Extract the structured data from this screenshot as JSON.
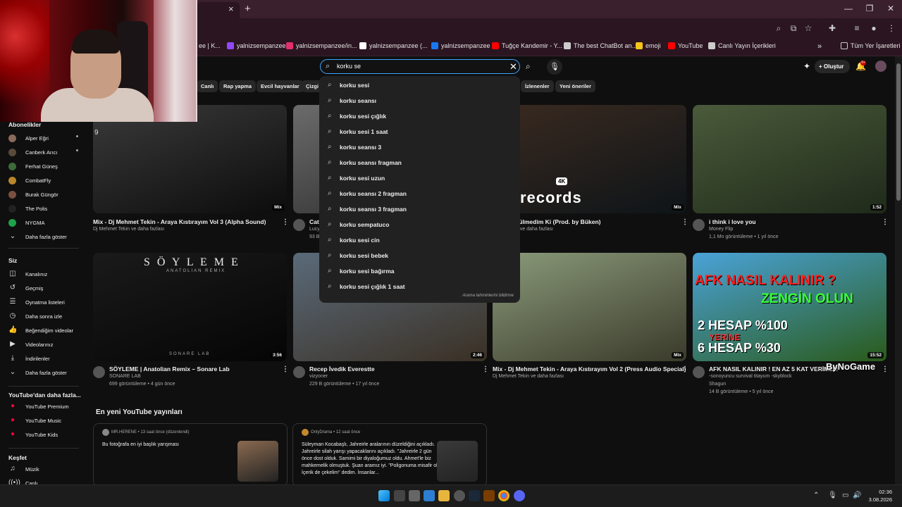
{
  "browser": {
    "tab_close": "×",
    "new_tab": "+",
    "window_controls": [
      "—",
      "❐",
      "✕"
    ],
    "bookmarks": [
      {
        "label": "ee | K...",
        "icon": "bookmark-icon"
      },
      {
        "label": "yalnizsempanzee",
        "icon": "twitch-icon",
        "color": "#9146ff"
      },
      {
        "label": "yalnizsempanzee/in...",
        "icon": "instagram-icon",
        "color": "#e1306c"
      },
      {
        "label": "yalnizsempanzee (...",
        "icon": "tiktok-icon",
        "color": "#ffffff"
      },
      {
        "label": "yalnizsempanzee",
        "icon": "facebook-icon",
        "color": "#1877f2"
      },
      {
        "label": "Tuğçe Kandemir - Y...",
        "icon": "youtube-icon",
        "color": "#ff0000"
      },
      {
        "label": "The best ChatBot an...",
        "icon": "chatbot-icon",
        "color": "#cccccc"
      },
      {
        "label": "emoji",
        "icon": "emoji-icon",
        "color": "#f5c518"
      },
      {
        "label": "YouTube",
        "icon": "youtube-icon",
        "color": "#ff0000"
      },
      {
        "label": "Canlı Yayın İçerikleri",
        "icon": "folder-icon",
        "color": "#cccccc"
      }
    ],
    "bookmarks_more": "»",
    "all_bookmarks": "Tüm Yer İşaretleri"
  },
  "search": {
    "value": "korku se",
    "clear": "✕",
    "suggestions": [
      "korku sesi",
      "korku seansı",
      "korku sesi çığlık",
      "korku sesi 1 saat",
      "korku seansı 3",
      "korku seansı fragman",
      "korku sesi uzun",
      "korku seansı 2 fragman",
      "korku seansı 3 fragman",
      "korku sempatuco",
      "korku sesi cin",
      "korku sesi bebek",
      "korku sesi bağırma",
      "korku sesi çığlık 1 saat"
    ],
    "report": "Arama tahminlerini bildirme"
  },
  "header": {
    "create": "Oluştur",
    "notif_count": "9+"
  },
  "chips": [
    {
      "label": "Canlı"
    },
    {
      "label": "Rap yapma"
    },
    {
      "label": "Evcil hayvanlar"
    },
    {
      "label": "Çizgi f"
    },
    {
      "label": "İzlenenler"
    },
    {
      "label": "Yeni öneriler"
    }
  ],
  "sidebar": {
    "subs_header": "Abonelikler",
    "subs": [
      {
        "label": "Alper Eğri",
        "color": "#8a6a5a"
      },
      {
        "label": "Canberk Arıcı",
        "color": "#5a4a3a"
      },
      {
        "label": "Ferhat Güneş",
        "color": "#3d6b3a"
      },
      {
        "label": "CombatFly",
        "color": "#b8862b"
      },
      {
        "label": "Burak Güngör",
        "color": "#7a5040"
      },
      {
        "label": "The Polis",
        "color": "#222222"
      },
      {
        "label": "NYGMA",
        "color": "#1fa14a"
      }
    ],
    "subs_more": "Daha fazla göster",
    "you_header": "Siz",
    "you_items": [
      {
        "label": "Kanalınız",
        "icon": "channel-icon"
      },
      {
        "label": "Geçmiş",
        "icon": "history-icon"
      },
      {
        "label": "Oynatma listeleri",
        "icon": "playlist-icon"
      },
      {
        "label": "Daha sonra izle",
        "icon": "clock-icon"
      },
      {
        "label": "Beğendiğim videolar",
        "icon": "like-icon"
      },
      {
        "label": "Videolarınız",
        "icon": "video-icon"
      },
      {
        "label": "İndirilenler",
        "icon": "download-icon"
      },
      {
        "label": "Daha fazla göster",
        "icon": "chevron-down-icon"
      }
    ],
    "more_header": "YouTube'dan daha fazla...",
    "more_items": [
      {
        "label": "YouTube Premium"
      },
      {
        "label": "YouTube Music"
      },
      {
        "label": "YouTube Kids"
      }
    ],
    "explore_header": "Keşfet",
    "explore_items": [
      {
        "label": "Müzik"
      },
      {
        "label": "Canlı"
      }
    ]
  },
  "videos": [
    {
      "title": "Mix - Dj Mehmet Tekin - Araya Kıstırayım Vol 3 (Alpha Sound)",
      "channel": "Dj Mehmet Tekin ve daha fazlası",
      "meta": "",
      "badge": "Mix",
      "thumb": [
        "#3a3a3a",
        "#0c0c0c"
      ]
    },
    {
      "title": "Cat",
      "channel": "Lucy",
      "meta": "93 B",
      "badge": "",
      "thumb": [
        "#6b6b6b",
        "#2a2a2a"
      ]
    },
    {
      "title": "cenk - Üzülmedim Ki (Prod. by Büken)",
      "channel": "cenk, Çağla ve daha fazlası",
      "meta": "",
      "badge": "Mix",
      "thumb": [
        "#3a2a20",
        "#0e1418"
      ]
    },
    {
      "title": "i think i love you",
      "channel": "Money Flip",
      "meta": "1,1 Mn görüntüleme • 1 yıl önce",
      "badge": "1:52",
      "thumb": [
        "#4a5a3a",
        "#1f2a1a"
      ]
    },
    {
      "title": "SÖYLEME | Anatolian Remix – Sonare Lab",
      "channel": "SONARE LAB",
      "meta": "699 görüntüleme • 4 gün önce",
      "badge": "3:56",
      "thumb": [
        "#1a1a1a",
        "#050505"
      ]
    },
    {
      "title": "Recep İvedik Everestte",
      "channel": "vizyoner",
      "meta": "229 B görüntüleme • 17 yıl önce",
      "badge": "2:46",
      "thumb": [
        "#5a6a7a",
        "#3a3024"
      ]
    },
    {
      "title": "Mix - Dj Mehmet Tekin - Araya Kıstırayım Vol 2 (Press Audio Special)",
      "channel": "Dj Mehmet Tekin ve daha fazlası",
      "meta": "",
      "badge": "Mix",
      "thumb": [
        "#8a9a7a",
        "#3a3a2a"
      ]
    },
    {
      "title": "AFK NASIL KALINIR ! EN AZ 5 KAT VERİMLİ !",
      "channel": "-sonoyuncu survival titayum -skyblock",
      "meta": "Shagun",
      "meta2": "14 B görüntüleme • 5 yıl önce",
      "badge": "15:52",
      "thumb": [
        "#4aa3d8",
        "#2a5a1a"
      ]
    }
  ],
  "thumb_text": {
    "records": "records",
    "rec_4k": "4K",
    "soyleme": "S Ö Y L E M E",
    "soyleme_sub": "ANATOLIAN REMIX",
    "sonare": "SONARE LAB",
    "afk1": "AFK NASIL KALINIR ?",
    "afk2": "ZENGİN OLUN",
    "afk3": "2 HESAP  %100",
    "afk4": "YERİNE",
    "afk5": "6 HESAP  %30",
    "row1_number": "9"
  },
  "posts_header": "En yeni YouTube yayınları",
  "posts": [
    {
      "author": "MR.HERENE • 13 saat önce (düzenlendi)",
      "body": "Bu fotoğrafa en iyi başlık yarışması",
      "img": "#8a6a50"
    },
    {
      "author": "OnlyDrama • 12 saat önce",
      "body": "Süleyman Kocabaşlı, Jahreirle aralarının düzeldiğini açıkladı. Jahreirle silah yarışı yapacaklarını açıkladı. \"Jahreirle 2 gün önce dost olduk. Samimi bir diyaloğumuz oldu. Ahmet'le biz mahkemelik olmuştuk. Şuan aramız iyi. \"Poligonuma misafir ol. İçerik de çekelim\" dedim. İnsanlar...",
      "img": "#3a3a3a"
    }
  ],
  "watermark": "ByNoGame",
  "taskbar": {
    "time": "02:36",
    "date": "3.08.2026"
  }
}
